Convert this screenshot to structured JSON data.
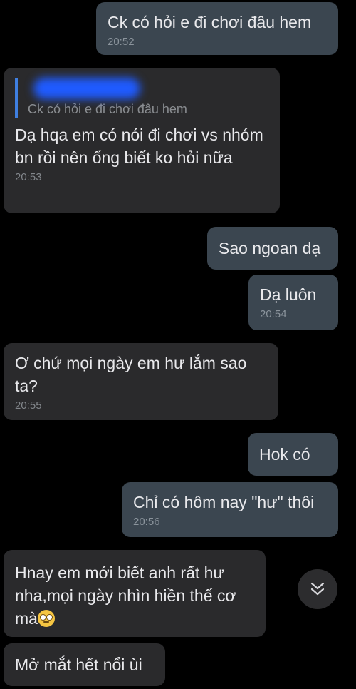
{
  "messages": [
    {
      "text": "Ck có hỏi e đi chơi đâu hem",
      "time": "20:52"
    },
    {
      "reply_to": "Ck có hỏi e đi chơi đâu hem",
      "text": "Dạ hqa em có nói đi chơi vs nhóm bn rồi nên ổng biết ko hỏi nữa",
      "time": "20:53"
    },
    {
      "text": "Sao ngoan dạ"
    },
    {
      "text": "Dạ luôn",
      "time": "20:54"
    },
    {
      "text": "Ơ chứ mọi ngày em hư lắm sao ta?",
      "time": "20:55"
    },
    {
      "text": "Hok có"
    },
    {
      "text": "Chỉ có hôm nay \"hư\" thôi",
      "time": "20:56"
    },
    {
      "text": "Hnay em mới biết anh rất hư nha,mọi ngày nhìn hiền thế cơ mà",
      "emoji": "face-with-rolling-eyes"
    },
    {
      "text": "Mở mắt hết nổi ùi"
    }
  ],
  "colors": {
    "background": "#000000",
    "sent_bubble": "#3b4650",
    "received_bubble": "#2a2a2c",
    "reply_accent": "#3f7fe0"
  },
  "scroll_button": {
    "icon": "double-chevron-down-icon"
  }
}
